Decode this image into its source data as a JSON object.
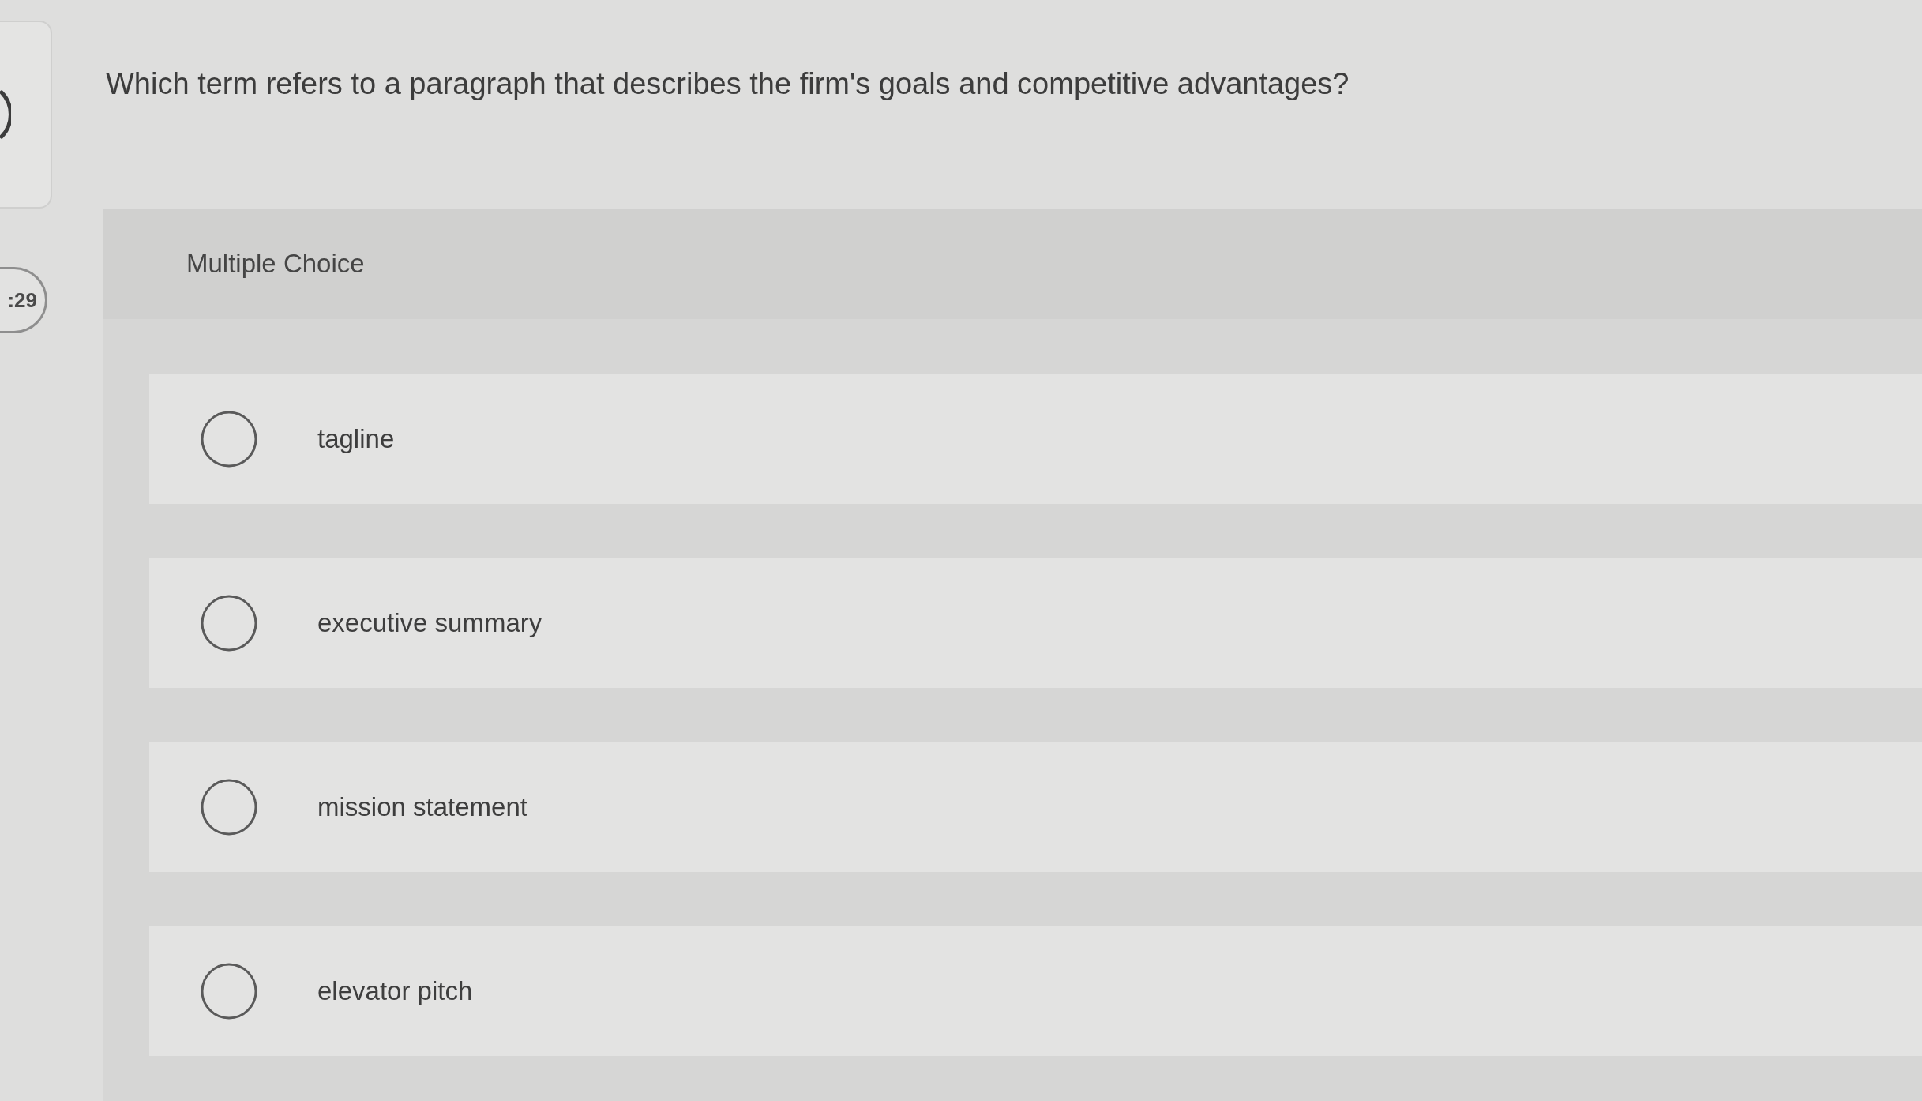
{
  "sidebar": {
    "timer": ":29"
  },
  "question": {
    "text": "Which term refers to a paragraph that describes the firm's goals and competitive advantages?",
    "type_label": "Multiple Choice",
    "options": [
      {
        "label": "tagline",
        "selected": false
      },
      {
        "label": "executive summary",
        "selected": false
      },
      {
        "label": "mission statement",
        "selected": false
      },
      {
        "label": "elevator pitch",
        "selected": false
      }
    ]
  }
}
